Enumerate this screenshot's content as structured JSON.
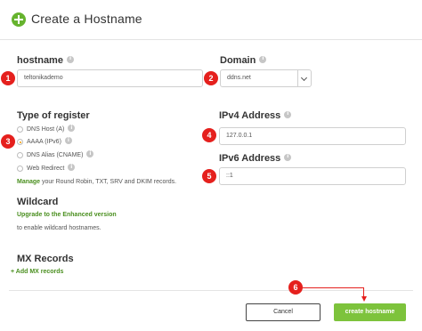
{
  "header": {
    "title": "Create a Hostname",
    "icon": "plus-circle-icon"
  },
  "hostname": {
    "label": "hostname",
    "value": "teltonikademo",
    "badge": "1"
  },
  "domain": {
    "label": "Domain",
    "value": "ddns.net",
    "badge": "2"
  },
  "register": {
    "label": "Type of register",
    "badge": "3",
    "options": [
      {
        "label": "DNS Host (A)",
        "checked": false
      },
      {
        "label": "AAAA (IPv6)",
        "checked": true
      },
      {
        "label": "DNS Alias (CNAME)",
        "checked": false
      },
      {
        "label": "Web Redirect",
        "checked": false
      }
    ],
    "manage_link": "Manage",
    "manage_text": " your Round Robin, TXT, SRV and DKIM records."
  },
  "ipv4": {
    "label": "IPv4 Address",
    "value": "127.0.0.1",
    "badge": "4"
  },
  "ipv6": {
    "label": "IPv6 Address",
    "value": "::1",
    "badge": "5"
  },
  "wildcard": {
    "label": "Wildcard",
    "upgrade_link": "Upgrade to the Enhanced version",
    "note": "to enable wildcard hostnames."
  },
  "mx": {
    "label": "MX Records",
    "add_link": "+ Add MX records"
  },
  "footer": {
    "cancel": "Cancel",
    "create": "create hostname",
    "badge": "6"
  },
  "colors": {
    "accent_green": "#7dc33c",
    "badge_red": "#e5201d",
    "radio_checked": "#f59a00"
  }
}
